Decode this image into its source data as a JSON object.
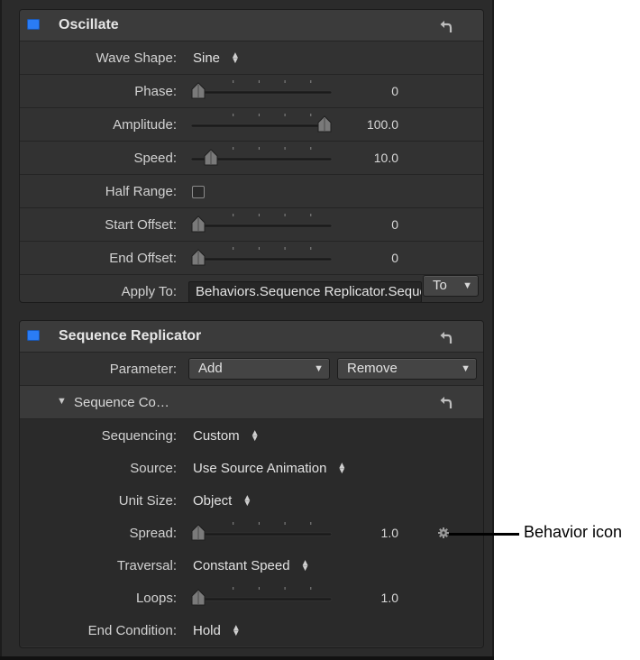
{
  "oscillate": {
    "title": "Oscillate",
    "rows": {
      "wave_shape": {
        "label": "Wave Shape:",
        "value": "Sine"
      },
      "phase": {
        "label": "Phase:",
        "value": "0",
        "slider_fraction": 0.0
      },
      "amplitude": {
        "label": "Amplitude:",
        "value": "100.0",
        "slider_fraction": 1.0
      },
      "speed": {
        "label": "Speed:",
        "value": "10.0",
        "slider_fraction": 0.1
      },
      "half_range": {
        "label": "Half Range:",
        "checked": false
      },
      "start_offset": {
        "label": "Start Offset:",
        "value": "0",
        "slider_fraction": 0.0
      },
      "end_offset": {
        "label": "End Offset:",
        "value": "0",
        "slider_fraction": 0.0
      },
      "apply_to": {
        "label": "Apply To:",
        "value": "Behaviors.Sequence Replicator.Sequence Control.Spread",
        "menu": "To"
      }
    }
  },
  "sequence_replicator": {
    "title": "Sequence Replicator",
    "parameter": {
      "label": "Parameter:",
      "add": "Add",
      "remove": "Remove"
    },
    "sequence_control": {
      "title": "Sequence Co…",
      "rows": {
        "sequencing": {
          "label": "Sequencing:",
          "value": "Custom"
        },
        "source": {
          "label": "Source:",
          "value": "Use Source Animation"
        },
        "unit_size": {
          "label": "Unit Size:",
          "value": "Object"
        },
        "spread": {
          "label": "Spread:",
          "value": "1.0",
          "slider_fraction": 0.0
        },
        "traversal": {
          "label": "Traversal:",
          "value": "Constant Speed"
        },
        "loops": {
          "label": "Loops:",
          "value": "1.0",
          "slider_fraction": 0.0
        },
        "end_condition": {
          "label": "End Condition:",
          "value": "Hold"
        }
      }
    }
  },
  "callout": {
    "label": "Behavior icon"
  },
  "icons": {
    "enable": "enable-checkbox-icon",
    "reset": "reset-arrow-icon",
    "behavior": "gear-icon",
    "disclosure": "disclosure-triangle-icon",
    "stepper": "up-down-arrows-icon"
  },
  "colors": {
    "accent": "#2a7cf5",
    "panel": "#2b2b2b",
    "text": "#d2d2d2"
  }
}
